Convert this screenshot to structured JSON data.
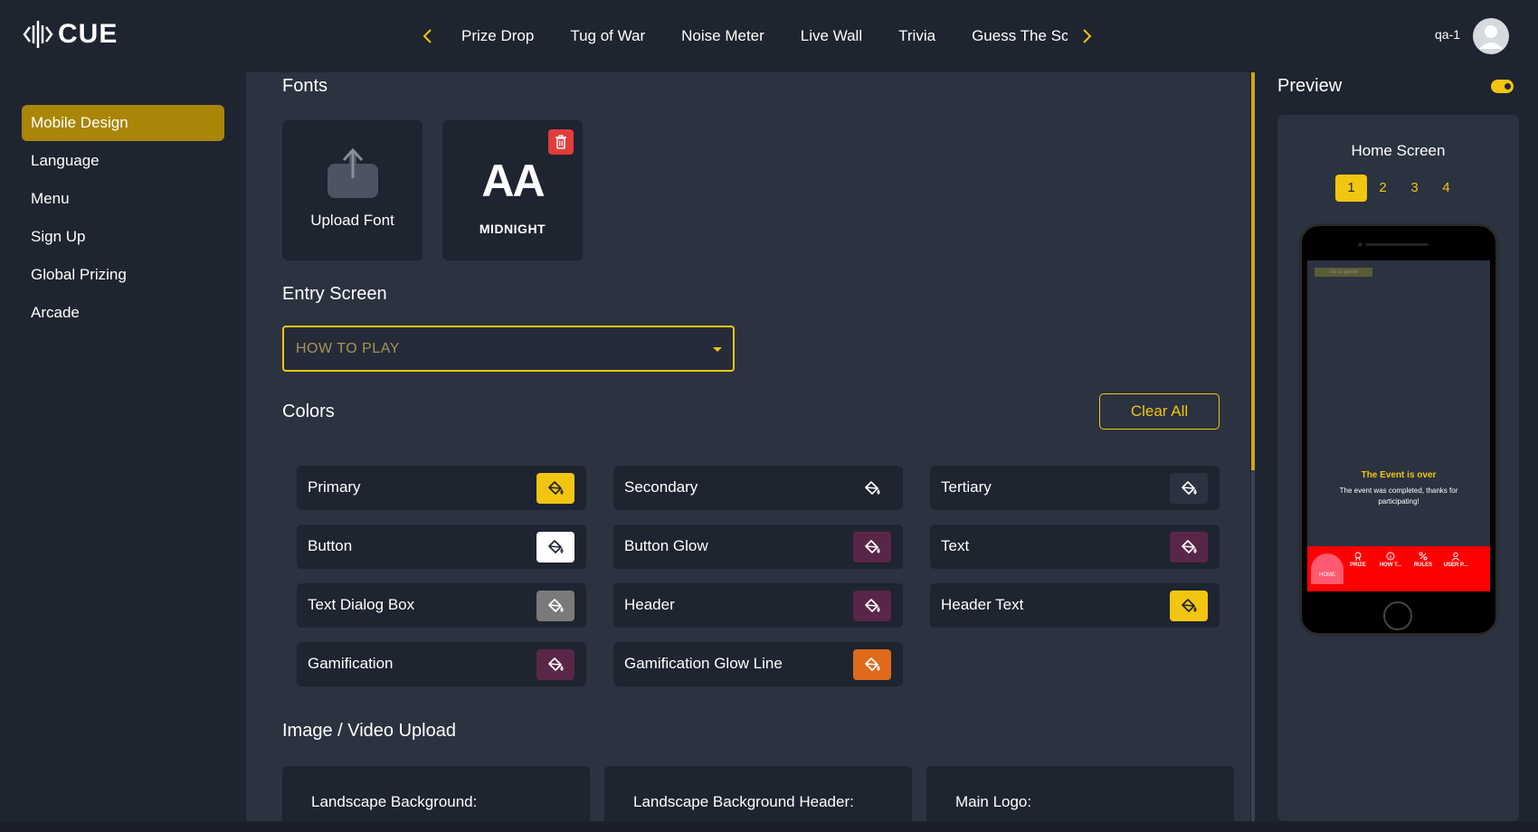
{
  "app": {
    "logo_text": "CUE",
    "user": "qa-1"
  },
  "nav": {
    "tabs": [
      "Prize Drop",
      "Tug of War",
      "Noise Meter",
      "Live Wall",
      "Trivia",
      "Guess The Sc"
    ]
  },
  "sidebar": {
    "items": [
      {
        "label": "Mobile Design",
        "active": true
      },
      {
        "label": "Language"
      },
      {
        "label": "Menu"
      },
      {
        "label": "Sign Up"
      },
      {
        "label": "Global Prizing"
      },
      {
        "label": "Arcade"
      }
    ]
  },
  "fonts": {
    "title": "Fonts",
    "upload_label": "Upload Font",
    "sample_glyph": "AA",
    "font_name": "MIDNIGHT"
  },
  "entry_screen": {
    "title": "Entry Screen",
    "value": "HOW TO PLAY"
  },
  "colors": {
    "title": "Colors",
    "clear_label": "Clear All",
    "items": [
      {
        "label": "Primary",
        "color": "#f2c511",
        "icon_color": "#1e2430"
      },
      {
        "label": "Secondary",
        "color": "#1e2430",
        "icon_color": "#ffffff"
      },
      {
        "label": "Tertiary",
        "color": "#2b3240",
        "icon_color": "#ffffff"
      },
      {
        "label": "Button",
        "color": "#ffffff",
        "icon_color": "#1e2430"
      },
      {
        "label": "Button Glow",
        "color": "#5a2648",
        "icon_color": "#ffffff"
      },
      {
        "label": "Text",
        "color": "#5a2648",
        "icon_color": "#ffffff"
      },
      {
        "label": "Text Dialog Box",
        "color": "#7a7a7a",
        "icon_color": "#ffffff"
      },
      {
        "label": "Header",
        "color": "#5a2648",
        "icon_color": "#ffffff"
      },
      {
        "label": "Header Text",
        "color": "#f2c511",
        "icon_color": "#1e2430"
      },
      {
        "label": "Gamification",
        "color": "#5a2648",
        "icon_color": "#ffffff"
      },
      {
        "label": "Gamification Glow Line",
        "color": "#e06a1b",
        "icon_color": "#ffffff"
      }
    ]
  },
  "uploads": {
    "title": "Image / Video Upload",
    "items": [
      "Landscape Background:",
      "Landscape Background Header:",
      "Main Logo:"
    ]
  },
  "preview": {
    "title": "Preview",
    "screen_name": "Home Screen",
    "pages": [
      "1",
      "2",
      "3",
      "4"
    ],
    "active_page": "1",
    "phone": {
      "go_game": "Go to game",
      "event_title": "The Event is over",
      "event_text": "The event was completed, thanks for participating!",
      "nav": [
        "HOME",
        "PRIZE",
        "HOW T...",
        "RULES",
        "USER P..."
      ]
    }
  }
}
